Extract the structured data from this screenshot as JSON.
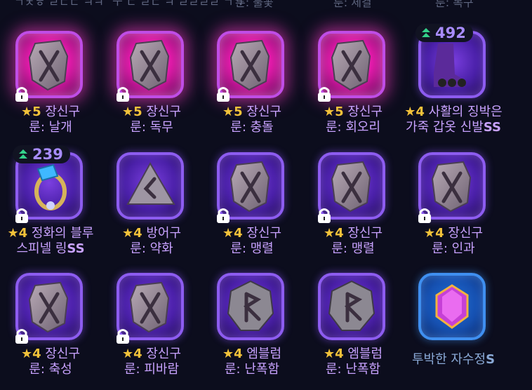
{
  "top_cutoff": [
    "ㄱㅊㅎ ㄹㄷㄷ ㅋㅋ",
    "ㅜ ㄷ ㄹㄷ ㅋ ㄹㄹㄹㄹ ㄱㄱ",
    "룬: 불꽃",
    "룬: 체결",
    "룬: 복구"
  ],
  "items": [
    {
      "star": "★",
      "grade": "5",
      "line1": "장신구",
      "line2": "룬: 날개",
      "frame": "pink",
      "art": "rune",
      "locked": true
    },
    {
      "star": "★",
      "grade": "5",
      "line1": "장신구",
      "line2": "룬: 독무",
      "frame": "pink",
      "art": "rune",
      "locked": true
    },
    {
      "star": "★",
      "grade": "5",
      "line1": "장신구",
      "line2": "룬: 충돌",
      "frame": "pink",
      "art": "rune",
      "locked": true
    },
    {
      "star": "★",
      "grade": "5",
      "line1": "장신구",
      "line2": "룬: 회오리",
      "frame": "pink",
      "art": "rune",
      "locked": true
    },
    {
      "star": "★",
      "grade": "4",
      "line1": "사활의 징박은",
      "line2": "가죽 갑옷 신발",
      "suffix": "SS",
      "frame": "purple",
      "art": "boots",
      "locked": false,
      "badge": "492"
    },
    {
      "star": "★",
      "grade": "4",
      "line1": "정화의 블루",
      "line2": "스피넬 링",
      "suffix": "SS",
      "frame": "purple",
      "art": "ring",
      "locked": true,
      "badge": "239"
    },
    {
      "star": "★",
      "grade": "4",
      "line1": "방어구",
      "line2": "룬: 약화",
      "frame": "purple",
      "art": "rune-tri",
      "locked": false
    },
    {
      "star": "★",
      "grade": "4",
      "line1": "장신구",
      "line2": "룬: 맹렬",
      "frame": "purple",
      "art": "rune",
      "locked": true
    },
    {
      "star": "★",
      "grade": "4",
      "line1": "장신구",
      "line2": "룬: 맹렬",
      "frame": "purple",
      "art": "rune",
      "locked": true
    },
    {
      "star": "★",
      "grade": "4",
      "line1": "장신구",
      "line2": "룬: 인과",
      "frame": "purple",
      "art": "rune",
      "locked": true
    },
    {
      "star": "★",
      "grade": "4",
      "line1": "장신구",
      "line2": "룬: 축성",
      "frame": "purple",
      "art": "rune",
      "locked": true
    },
    {
      "star": "★",
      "grade": "4",
      "line1": "장신구",
      "line2": "룬: 피바람",
      "frame": "purple",
      "art": "rune",
      "locked": true
    },
    {
      "star": "★",
      "grade": "4",
      "line1": "엠블럼",
      "line2": "룬: 난폭함",
      "frame": "purple",
      "art": "emblem",
      "locked": false
    },
    {
      "star": "★",
      "grade": "4",
      "line1": "엠블럼",
      "line2": "룬: 난폭함",
      "frame": "purple",
      "art": "emblem",
      "locked": false
    },
    {
      "plain": "투박한 자수정",
      "suffix": "S",
      "frame": "blue",
      "art": "gem",
      "locked": false
    }
  ],
  "icons": {
    "lock": "lock-icon",
    "badge": "stack-level-icon"
  },
  "colors": {
    "star": "#f2c23a",
    "name": "#c8a2ff",
    "pink_frame": "#ff4fd2",
    "purple_frame": "#8d5cf0",
    "blue_frame": "#3f8ff0"
  }
}
